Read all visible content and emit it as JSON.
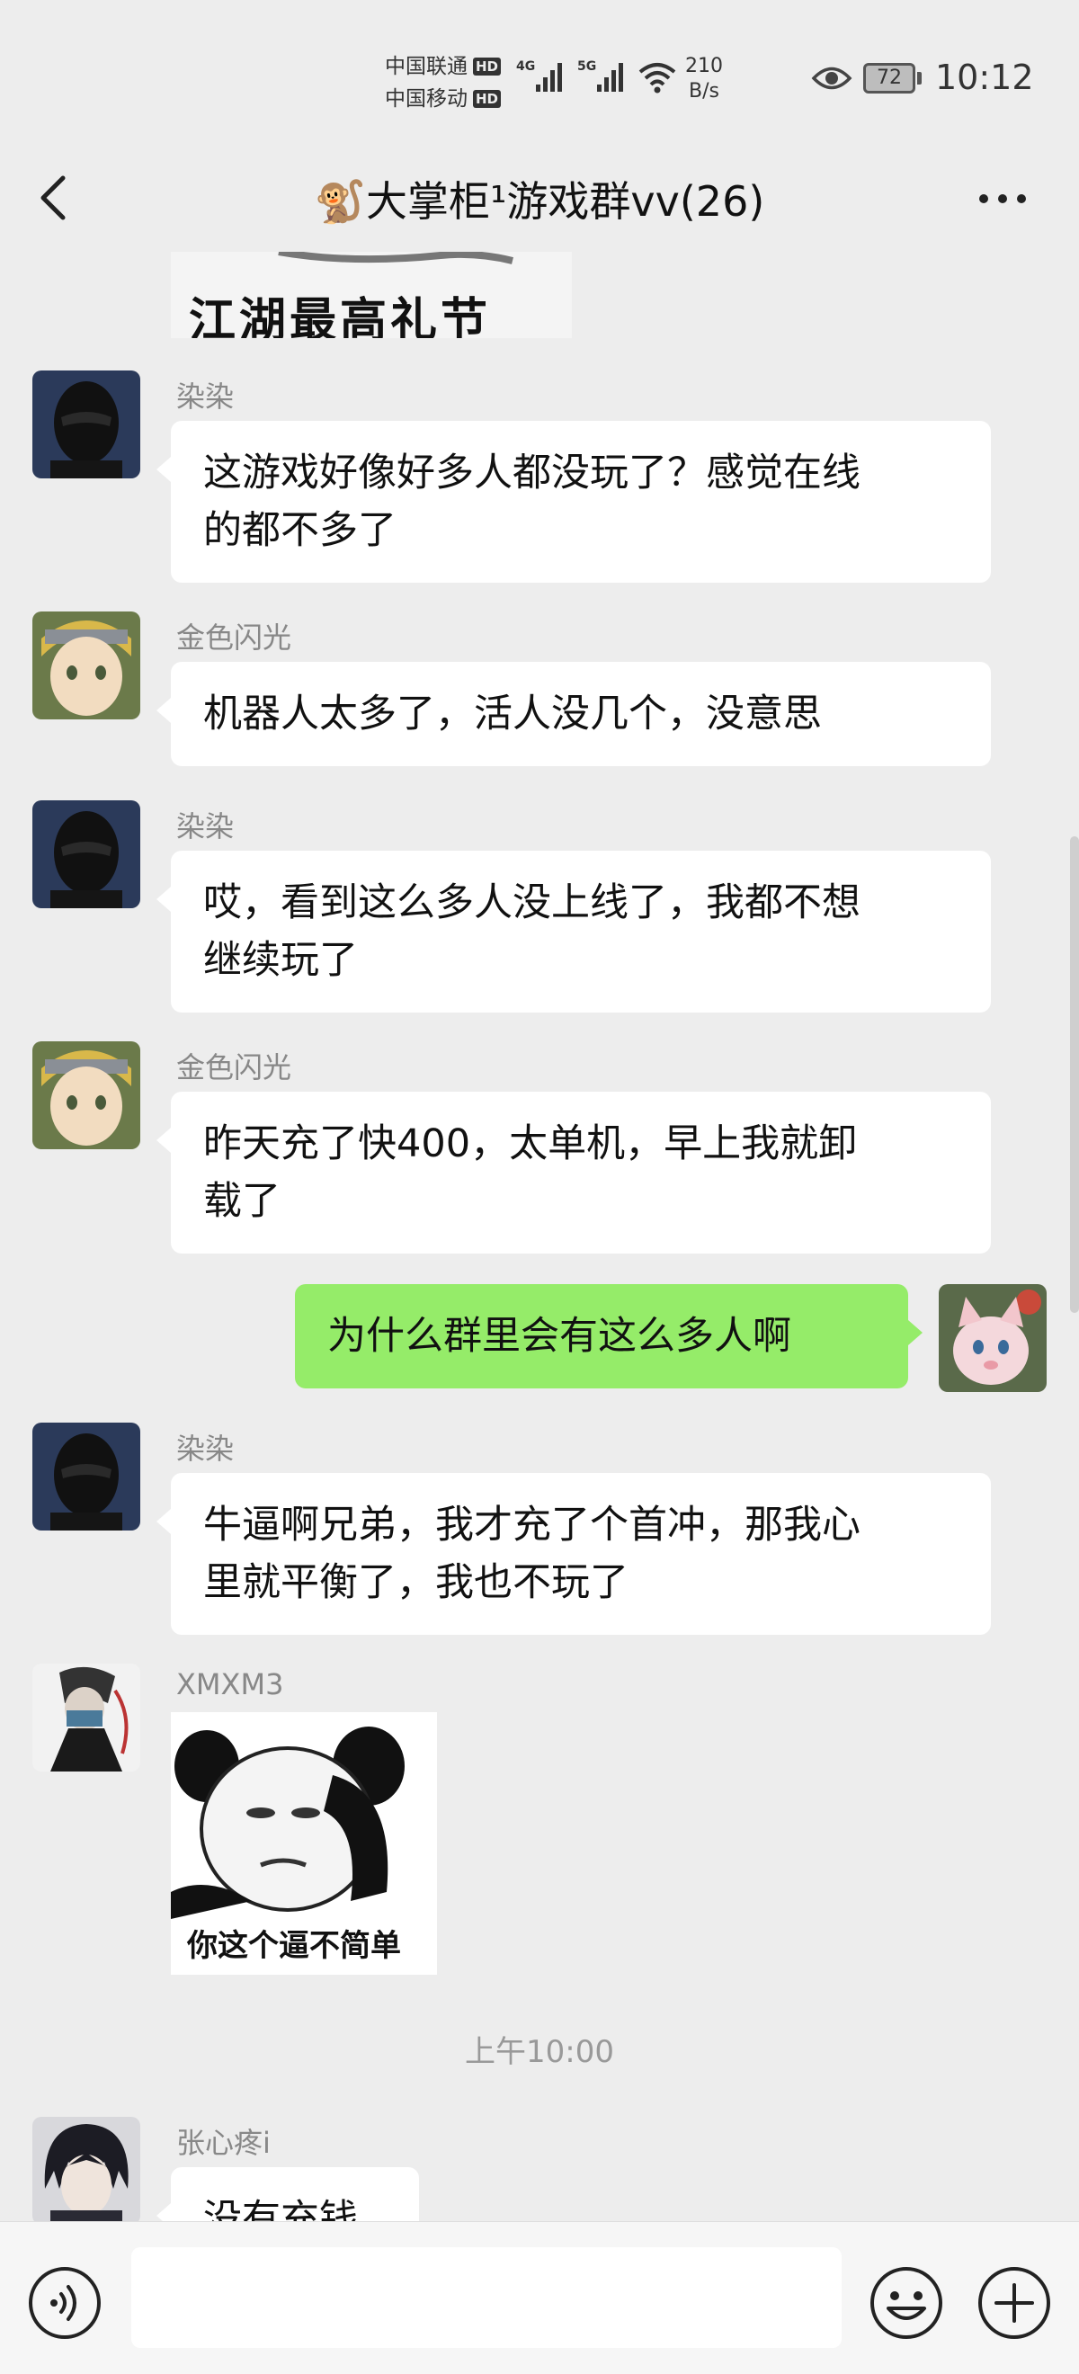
{
  "status_bar": {
    "carrier1": "中国联通",
    "carrier2": "中国移动",
    "hd": "HD",
    "net1": "4G",
    "net2": "5G",
    "speed_value": "210",
    "speed_unit": "B/s",
    "battery": "72",
    "time": "10:12"
  },
  "header": {
    "title": "🐒大掌柜¹游戏群vv(26)",
    "back_icon": "chevron-left-icon",
    "more_icon": "more-horizontal-icon"
  },
  "messages": [
    {
      "type": "sticker",
      "sender": "",
      "caption": "江湖最高礼节",
      "partial": true
    },
    {
      "type": "text",
      "sender": "染染",
      "avatar": "black-helmet-avatar",
      "text_lines": [
        "这游戏好像好多人都没玩了？感觉在线",
        "的都不多了"
      ]
    },
    {
      "type": "text",
      "sender": "金色闪光",
      "avatar": "anime-blonde-avatar",
      "text_lines": [
        "机器人太多了，活人没几个，没意思"
      ]
    },
    {
      "type": "text",
      "sender": "染染",
      "avatar": "black-helmet-avatar",
      "text_lines": [
        "哎，看到这么多人没上线了，我都不想",
        "继续玩了"
      ]
    },
    {
      "type": "text",
      "sender": "金色闪光",
      "avatar": "anime-blonde-avatar",
      "text_lines": [
        "昨天充了快400，太单机，早上我就卸",
        "载了"
      ]
    },
    {
      "type": "text",
      "sender": "me",
      "avatar": "pink-cat-avatar",
      "text_lines": [
        "为什么群里会有这么多人啊"
      ]
    },
    {
      "type": "text",
      "sender": "染染",
      "avatar": "black-helmet-avatar",
      "text_lines": [
        "牛逼啊兄弟，我才充了个首冲，那我心",
        "里就平衡了，我也不玩了"
      ]
    },
    {
      "type": "sticker",
      "sender": "XMXM3",
      "avatar": "masked-ninja-avatar",
      "caption": "你这个逼不简单"
    },
    {
      "type": "timestamp",
      "text": "上午10:00"
    },
    {
      "type": "text",
      "sender": "张心疼i",
      "avatar": "dark-hair-anime-avatar",
      "text_lines": [
        "没有充钱"
      ],
      "partial": true
    }
  ],
  "input_bar": {
    "placeholder": "",
    "voice_icon": "voice-icon",
    "emoji_icon": "emoji-icon",
    "add_icon": "plus-circle-icon"
  },
  "colors": {
    "background": "#ededed",
    "my_bubble": "#95ec69",
    "other_bubble": "#ffffff",
    "sender_name": "#888888"
  }
}
